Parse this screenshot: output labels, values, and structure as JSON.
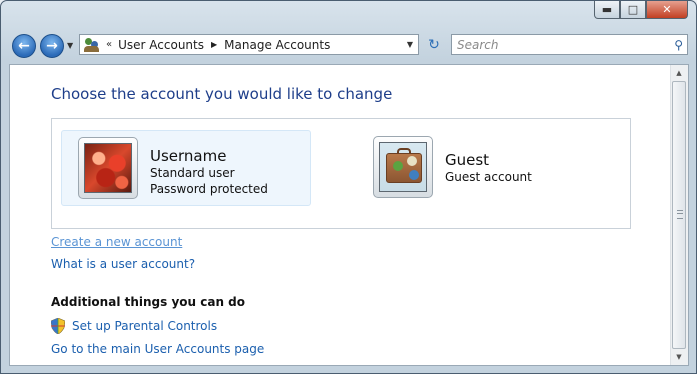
{
  "window": {
    "caption_buttons": {
      "minimize": "▬",
      "maximize": "□",
      "close": "✕"
    }
  },
  "nav": {
    "back": "←",
    "forward": "→",
    "dropdown": "▼"
  },
  "address": {
    "chevron": "«",
    "crumbs": [
      "User Accounts",
      "Manage Accounts"
    ],
    "separator": "▶",
    "dropdown": "▼"
  },
  "refresh": "↻",
  "search": {
    "placeholder": "Search",
    "icon": "⚲"
  },
  "page": {
    "title": "Choose the account you would like to change",
    "accounts": [
      {
        "name": "Username",
        "line1": "Standard user",
        "line2": "Password protected",
        "picture": "red-leaves",
        "selected": true
      },
      {
        "name": "Guest",
        "line1": "Guest account",
        "picture": "suitcase",
        "selected": false
      }
    ],
    "links": {
      "create": "Create a new account",
      "what": "What is a user account?"
    },
    "additional": {
      "heading": "Additional things you can do",
      "parental": "Set up Parental Controls",
      "main_page": "Go to the main User Accounts page"
    }
  },
  "scrollbar": {
    "up": "▲",
    "down": "▼"
  },
  "colors": {
    "link": "#1b5fae",
    "title": "#1e3e8a",
    "visited_link": "#5a94d4"
  }
}
